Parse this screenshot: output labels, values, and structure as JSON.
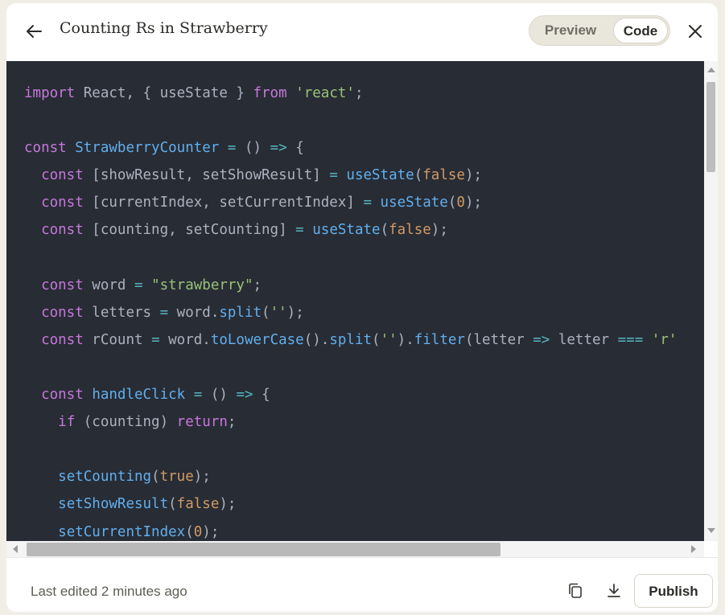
{
  "header": {
    "title": "Counting Rs in Strawberry",
    "tab_preview": "Preview",
    "tab_code": "Code",
    "back_icon": "arrow-left-icon",
    "close_icon": "close-icon"
  },
  "code": {
    "lines": [
      [
        [
          "import",
          "kw"
        ],
        [
          " React, { useState } ",
          "id"
        ],
        [
          "from",
          "kw"
        ],
        [
          " ",
          "id"
        ],
        [
          "'react'",
          "str"
        ],
        [
          ";",
          "id"
        ]
      ],
      [],
      [
        [
          "const",
          "kw"
        ],
        [
          " ",
          "id"
        ],
        [
          "StrawberryCounter",
          "fn"
        ],
        [
          " ",
          "id"
        ],
        [
          "=",
          "op"
        ],
        [
          " () ",
          "id"
        ],
        [
          "=>",
          "op"
        ],
        [
          " {",
          "id"
        ]
      ],
      [
        [
          "  ",
          "id"
        ],
        [
          "const",
          "kw"
        ],
        [
          " [showResult, setShowResult] ",
          "id"
        ],
        [
          "=",
          "op"
        ],
        [
          " ",
          "id"
        ],
        [
          "useState",
          "fn"
        ],
        [
          "(",
          "id"
        ],
        [
          "false",
          "num"
        ],
        [
          ");",
          "id"
        ]
      ],
      [
        [
          "  ",
          "id"
        ],
        [
          "const",
          "kw"
        ],
        [
          " [currentIndex, setCurrentIndex] ",
          "id"
        ],
        [
          "=",
          "op"
        ],
        [
          " ",
          "id"
        ],
        [
          "useState",
          "fn"
        ],
        [
          "(",
          "id"
        ],
        [
          "0",
          "num"
        ],
        [
          ");",
          "id"
        ]
      ],
      [
        [
          "  ",
          "id"
        ],
        [
          "const",
          "kw"
        ],
        [
          " [counting, setCounting] ",
          "id"
        ],
        [
          "=",
          "op"
        ],
        [
          " ",
          "id"
        ],
        [
          "useState",
          "fn"
        ],
        [
          "(",
          "id"
        ],
        [
          "false",
          "num"
        ],
        [
          ");",
          "id"
        ]
      ],
      [],
      [
        [
          "  ",
          "id"
        ],
        [
          "const",
          "kw"
        ],
        [
          " word ",
          "id"
        ],
        [
          "=",
          "op"
        ],
        [
          " ",
          "id"
        ],
        [
          "\"strawberry\"",
          "str"
        ],
        [
          ";",
          "id"
        ]
      ],
      [
        [
          "  ",
          "id"
        ],
        [
          "const",
          "kw"
        ],
        [
          " letters ",
          "id"
        ],
        [
          "=",
          "op"
        ],
        [
          " word.",
          "id"
        ],
        [
          "split",
          "fn"
        ],
        [
          "(",
          "id"
        ],
        [
          "''",
          "str"
        ],
        [
          ");",
          "id"
        ]
      ],
      [
        [
          "  ",
          "id"
        ],
        [
          "const",
          "kw"
        ],
        [
          " rCount ",
          "id"
        ],
        [
          "=",
          "op"
        ],
        [
          " word.",
          "id"
        ],
        [
          "toLowerCase",
          "fn"
        ],
        [
          "().",
          "id"
        ],
        [
          "split",
          "fn"
        ],
        [
          "(",
          "id"
        ],
        [
          "''",
          "str"
        ],
        [
          ").",
          "id"
        ],
        [
          "filter",
          "fn"
        ],
        [
          "(letter ",
          "id"
        ],
        [
          "=>",
          "op"
        ],
        [
          " letter ",
          "id"
        ],
        [
          "===",
          "op"
        ],
        [
          " ",
          "id"
        ],
        [
          "'r'",
          "str"
        ]
      ],
      [],
      [
        [
          "  ",
          "id"
        ],
        [
          "const",
          "kw"
        ],
        [
          " ",
          "id"
        ],
        [
          "handleClick",
          "fn"
        ],
        [
          " ",
          "id"
        ],
        [
          "=",
          "op"
        ],
        [
          " () ",
          "id"
        ],
        [
          "=>",
          "op"
        ],
        [
          " {",
          "id"
        ]
      ],
      [
        [
          "    ",
          "id"
        ],
        [
          "if",
          "kw"
        ],
        [
          " (counting) ",
          "id"
        ],
        [
          "return",
          "kw"
        ],
        [
          ";",
          "id"
        ]
      ],
      [],
      [
        [
          "    ",
          "id"
        ],
        [
          "setCounting",
          "fn"
        ],
        [
          "(",
          "id"
        ],
        [
          "true",
          "num"
        ],
        [
          ");",
          "id"
        ]
      ],
      [
        [
          "    ",
          "id"
        ],
        [
          "setShowResult",
          "fn"
        ],
        [
          "(",
          "id"
        ],
        [
          "false",
          "num"
        ],
        [
          ");",
          "id"
        ]
      ],
      [
        [
          "    ",
          "id"
        ],
        [
          "setCurrentIndex",
          "fn"
        ],
        [
          "(",
          "id"
        ],
        [
          "0",
          "num"
        ],
        [
          ");",
          "id"
        ]
      ]
    ]
  },
  "footer": {
    "last_edited": "Last edited 2 minutes ago",
    "publish_label": "Publish",
    "copy_icon": "copy-icon",
    "download_icon": "download-icon"
  },
  "colors": {
    "code_bg": "#282c34",
    "keyword": "#c678dd",
    "function": "#61afef",
    "string": "#98c379",
    "number": "#d19a66",
    "operator": "#56b6c2",
    "identifier": "#abb2bf"
  }
}
